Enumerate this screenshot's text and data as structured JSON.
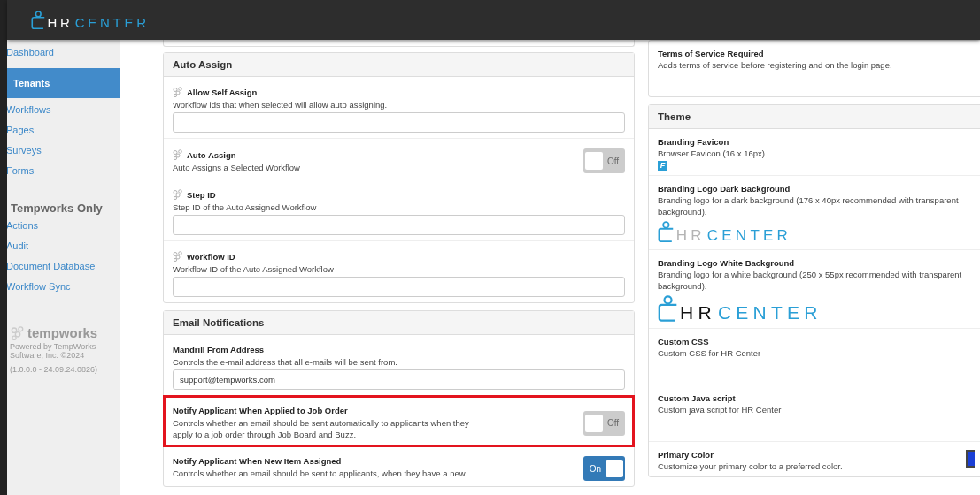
{
  "header": {
    "logo": {
      "first": "HR",
      "second": "CENTER"
    }
  },
  "sidebar": {
    "items": [
      {
        "label": "Dashboard",
        "selected": false
      },
      {
        "label": "Tenants",
        "selected": true
      },
      {
        "label": "Workflows",
        "selected": false
      },
      {
        "label": "Pages",
        "selected": false
      },
      {
        "label": "Surveys",
        "selected": false
      },
      {
        "label": "Forms",
        "selected": false
      }
    ],
    "section_title": "Tempworks Only",
    "section_items": [
      {
        "label": "Actions",
        "selected": false
      },
      {
        "label": "Audit",
        "selected": false
      },
      {
        "label": "Document Database",
        "selected": false
      },
      {
        "label": "Workflow Sync",
        "selected": false
      }
    ],
    "footer": {
      "brand": "tempworks",
      "powered_by": "Powered by TempWorks Software, Inc. ©2024",
      "version": "(1.0.0.0 - 24.09.24.0826)"
    }
  },
  "left_column": {
    "panels": [
      {
        "title": "Auto Assign",
        "items": [
          {
            "kind": "text",
            "label": "Allow Self Assign",
            "description": "Workflow ids that when selected will allow auto assigning.",
            "icon": true,
            "highlighted": false
          },
          {
            "kind": "toggle",
            "label": "Auto Assign",
            "description": "Auto Assigns a Selected Workflow",
            "icon": true,
            "highlighted": false,
            "on": false,
            "toggle_label": "Off"
          },
          {
            "kind": "text",
            "label": "Step ID",
            "description": "Step ID of the Auto Assigned Workflow",
            "icon": true,
            "highlighted": false
          },
          {
            "kind": "text",
            "label": "Workflow ID",
            "description": "Workflow ID of the Auto Assigned Workflow",
            "icon": true,
            "highlighted": false
          }
        ]
      },
      {
        "title": "Email Notifications",
        "items": [
          {
            "kind": "text",
            "label": "Mandrill From Address",
            "description": "Controls the e-mail address that all e-mails will be sent from.",
            "icon": false,
            "highlighted": false,
            "value": "support@tempworks.com"
          },
          {
            "kind": "toggle",
            "label": "Notify Applicant When Applied to Job Order",
            "description": "Controls whether an email should be sent automatically to applicants when they apply to a job order through Job Board and Buzz.",
            "icon": false,
            "highlighted": true,
            "on": false,
            "toggle_label": "Off"
          },
          {
            "kind": "toggle",
            "label": "Notify Applicant When New Item Assigned",
            "description": "Controls whether an email should be sent to applicants, when they have a new",
            "icon": false,
            "highlighted": false,
            "on": true,
            "toggle_label": "On"
          }
        ]
      }
    ]
  },
  "right_column": {
    "panels": [
      {
        "items": [
          {
            "kind": "info",
            "label": "Terms of Service Required",
            "description": "Adds terms of service before registering and on the login page."
          }
        ]
      },
      {
        "title": "Theme",
        "items": [
          {
            "kind": "favicon",
            "label": "Branding Favicon",
            "description": "Browser Favicon (16 x 16px).",
            "favicon_text": "F"
          },
          {
            "kind": "logo_dark",
            "label": "Branding Logo Dark Background",
            "description": "Branding logo for a dark background (176 x 40px recommended with transparent background).",
            "logo": {
              "first": "HR",
              "second": "CENTER"
            }
          },
          {
            "kind": "logo_white",
            "label": "Branding Logo White Background",
            "description": "Branding logo for a white background (250 x 55px recommended with transparent background).",
            "logo": {
              "first": "HR",
              "second": "CENTER"
            }
          },
          {
            "kind": "info",
            "label": "Custom CSS",
            "description": "Custom CSS for HR Center"
          },
          {
            "kind": "info",
            "label": "Custom Java script",
            "description": "Custom java script for HR Center"
          },
          {
            "kind": "color",
            "label": "Primary Color",
            "description": "Customize your primary color to a preferred color."
          }
        ]
      }
    ]
  }
}
